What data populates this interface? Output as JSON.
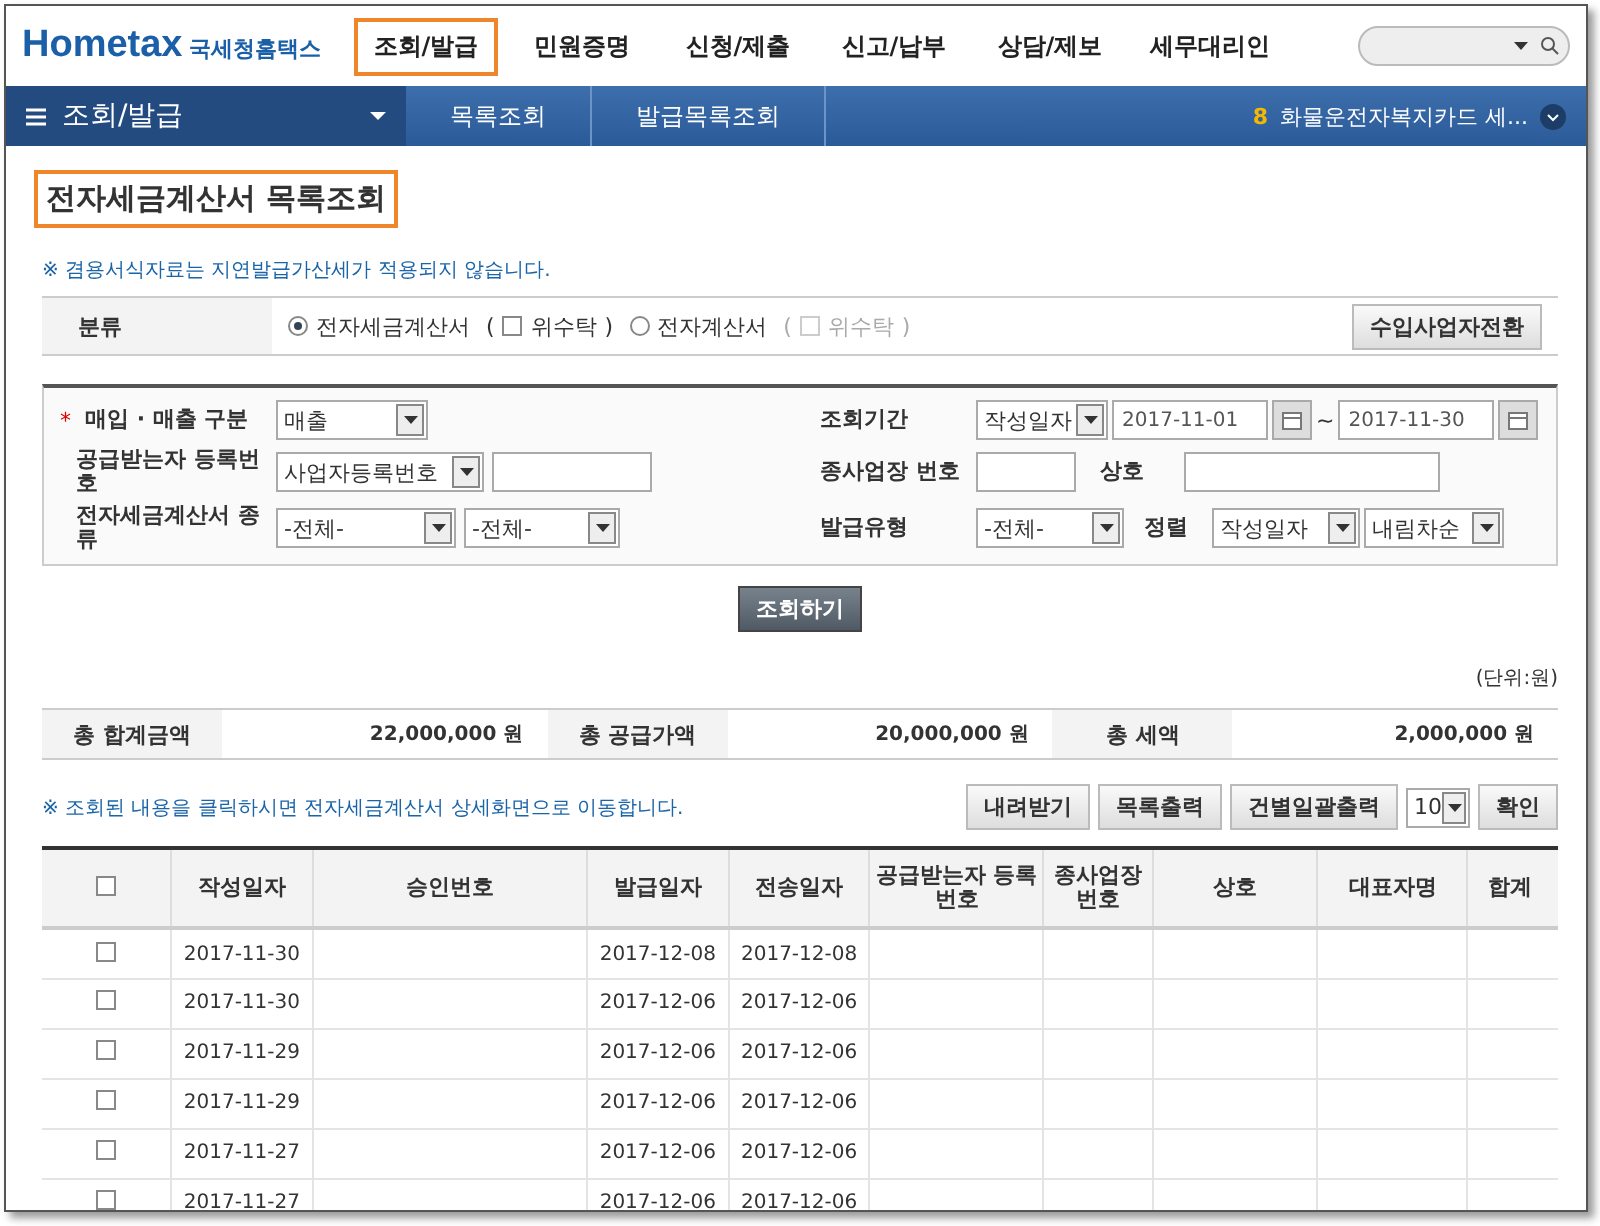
{
  "header": {
    "logo": "Hometax",
    "logo_sub": "국세청홈택스",
    "nav": [
      {
        "label": "조회/발급",
        "selected": true
      },
      {
        "label": "민원증명",
        "selected": false
      },
      {
        "label": "신청/제출",
        "selected": false
      },
      {
        "label": "신고/납부",
        "selected": false
      },
      {
        "label": "상담/제보",
        "selected": false
      },
      {
        "label": "세무대리인",
        "selected": false
      }
    ]
  },
  "subnav": {
    "menu": "조회/발급",
    "crumbs": [
      "목록조회",
      "발급목록조회"
    ],
    "notice_count": "8",
    "notice": "화물운전자복지카드 세..."
  },
  "page_title": "전자세금계산서 목록조회",
  "note": "※ 겸용서식자료는 지연발급가산세가 적용되지 않습니다.",
  "category": {
    "label": "분류",
    "options": [
      {
        "label": "전자세금계산서",
        "selected": true,
        "open": "(",
        "trust": "위수탁",
        "close": ")",
        "trust_checked": false,
        "trust_disabled": false
      },
      {
        "label": "전자계산서",
        "selected": false,
        "open": "(",
        "trust": "위수탁",
        "close": ")",
        "trust_checked": false,
        "trust_disabled": true
      }
    ],
    "button": "수입사업자전환"
  },
  "filters": {
    "trade_type": {
      "required_mark": "*",
      "label": "매입 · 매출 구분",
      "value": "매출"
    },
    "period": {
      "label": "조회기간",
      "type": "작성일자",
      "from": "2017-11-01",
      "to": "2017-11-30",
      "sep": "~"
    },
    "receiver": {
      "label": "공급받는자 등록번호",
      "type": "사업자등록번호"
    },
    "branch": {
      "label": "종사업장 번호"
    },
    "company": {
      "label": "상호"
    },
    "kind": {
      "label": "전자세금계산서 종류",
      "value1": "-전체-",
      "value2": "-전체-"
    },
    "issue_type": {
      "label": "발급유형",
      "value": "-전체-"
    },
    "sort": {
      "label": "정렬",
      "field": "작성일자",
      "order": "내림차순"
    }
  },
  "search_button": "조회하기",
  "unit": "(단위:원)",
  "totals": [
    {
      "label": "총 합계금액",
      "value": "22,000,000 원"
    },
    {
      "label": "총 공급가액",
      "value": "20,000,000 원"
    },
    {
      "label": "총 세액",
      "value": "2,000,000 원"
    }
  ],
  "list_note": "※ 조회된 내용을 클릭하시면 전자세금계산서 상세화면으로 이동합니다.",
  "actions": [
    "내려받기",
    "목록출력",
    "건별일괄출력"
  ],
  "page_size": "10",
  "confirm": "확인",
  "table": {
    "all_checked": false,
    "columns": [
      "작성일자",
      "승인번호",
      "발급일자",
      "전송일자",
      "공급받는자 등록번호",
      "종사업장 번호",
      "상호",
      "대표자명",
      "합계"
    ],
    "rows": [
      {
        "checked": false,
        "cells": [
          "2017-11-30",
          "",
          "2017-12-08",
          "2017-12-08"
        ]
      },
      {
        "checked": false,
        "cells": [
          "2017-11-30",
          "",
          "2017-12-06",
          "2017-12-06"
        ]
      },
      {
        "checked": false,
        "cells": [
          "2017-11-29",
          "",
          "2017-12-06",
          "2017-12-06"
        ]
      },
      {
        "checked": false,
        "cells": [
          "2017-11-29",
          "",
          "2017-12-06",
          "2017-12-06"
        ]
      },
      {
        "checked": false,
        "cells": [
          "2017-11-27",
          "",
          "2017-12-06",
          "2017-12-06"
        ]
      },
      {
        "checked": false,
        "cells": [
          "2017-11-27",
          "",
          "2017-12-06",
          "2017-12-06"
        ]
      }
    ]
  }
}
